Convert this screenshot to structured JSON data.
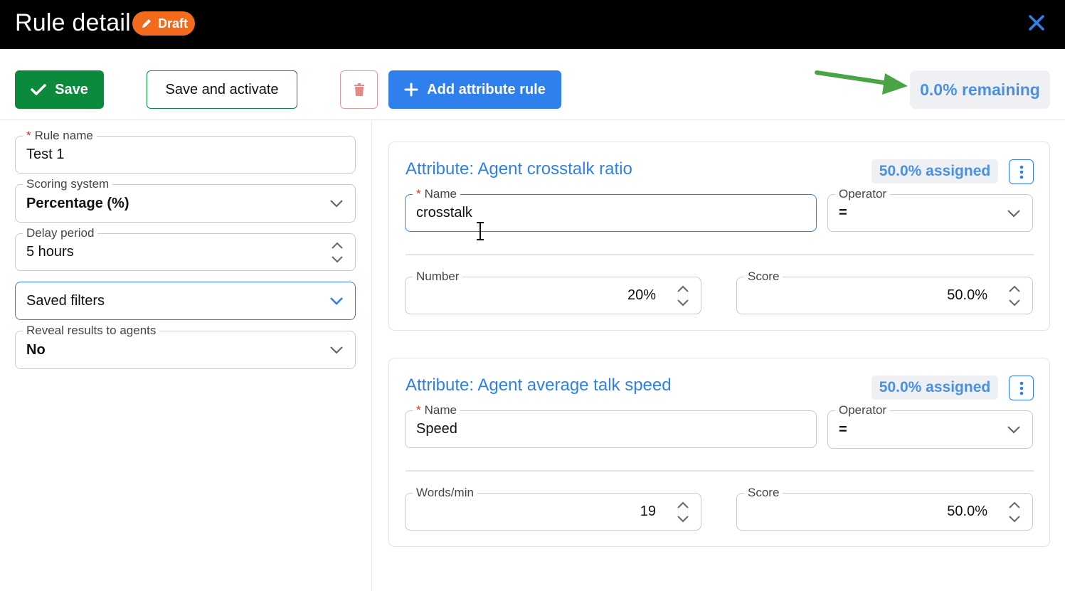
{
  "header": {
    "title": "Rule detail",
    "badge": "Draft",
    "badge_color": "#f26b1d"
  },
  "toolbar": {
    "save_label": "Save",
    "save_activate_label": "Save and activate",
    "add_rule_label": "Add attribute rule",
    "remaining": "0.0% remaining",
    "accent": "#2f80ed",
    "success": "#0c8a3c"
  },
  "rule": {
    "name_label": "Rule name",
    "name_value": "Test 1",
    "scoring_label": "Scoring system",
    "scoring_value": "Percentage (%)",
    "delay_label": "Delay period",
    "delay_value": "5 hours",
    "filters_value": "Saved filters",
    "reveal_label": "Reveal results to agents",
    "reveal_value": "No"
  },
  "attributes": [
    {
      "title": "Attribute: Agent crosstalk ratio",
      "assigned": "50.0% assigned",
      "name_label": "Name",
      "name_value": "crosstalk",
      "operator_label": "Operator",
      "operator_value": "=",
      "metric_label": "Number",
      "metric_value": "20%",
      "score_label": "Score",
      "score_value": "50.0%"
    },
    {
      "title": "Attribute: Agent average talk speed",
      "assigned": "50.0% assigned",
      "name_label": "Name",
      "name_value": "Speed",
      "operator_label": "Operator",
      "operator_value": "=",
      "metric_label": "Words/min",
      "metric_value": "19",
      "score_label": "Score",
      "score_value": "50.0%"
    }
  ],
  "icons": {
    "close": "close-icon",
    "check": "check-icon",
    "trash": "trash-icon",
    "plus": "plus-icon",
    "pencil": "pencil-icon",
    "chevron": "chevron-down-icon",
    "spinner": "stepper-icon",
    "kebab": "kebab-icon",
    "arrow": "arrow-right-icon"
  }
}
